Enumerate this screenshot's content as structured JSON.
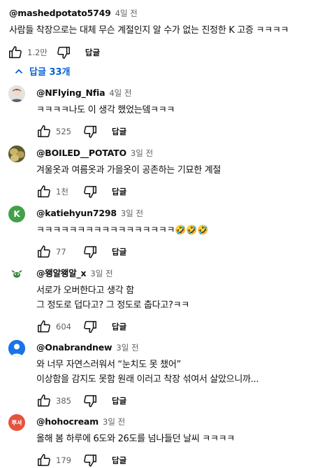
{
  "top_comment": {
    "handle": "@mashedpotato5749",
    "time": "4일 전",
    "text": "사람들 착장으로는 대체 무슨 계절인지 알 수가 없는 진정한 K 고증 ㅋㅋㅋㅋ",
    "likes": "1.2만",
    "reply_label": "답글"
  },
  "replies_toggle": {
    "label": "답글 33개",
    "icon": "chevron-up-icon",
    "color": "#065fd4"
  },
  "replies": [
    {
      "handle": "@NFlying_Nfia",
      "time": "4일 전",
      "lines": [
        "ㅋㅋㅋㅋ나도 이 생각 했었는뎈ㅋㅋㅋ"
      ],
      "likes": "525",
      "reply_label": "답글"
    },
    {
      "handle": "@BOILED__POTATO",
      "time": "3일 전",
      "lines": [
        "겨울옷과 여름옷과 가을옷이 공존하는 기묘한 계절"
      ],
      "likes": "1천",
      "reply_label": "답글"
    },
    {
      "handle": "@katiehyun7298",
      "time": "3일 전",
      "lines": [
        "ㅋㅋㅋㅋㅋㅋㅋㅋㅋㅋㅋㅋㅋㅋㅋㅋㅋ🤣🤣🤣"
      ],
      "likes": "77",
      "reply_label": "답글",
      "avatar_letter": "K"
    },
    {
      "handle": "@왱알왱알_x",
      "time": "3일 전",
      "lines": [
        "서로가 오버한다고 생각 함",
        "그 정도로 덥다고? 그 정도로 춥다고?ㅋㅋ"
      ],
      "likes": "604",
      "reply_label": "답글"
    },
    {
      "handle": "@Onabrandnew",
      "time": "3일 전",
      "lines": [
        "와 너무 자연스러워서 “눈치도 못 챘어”",
        "이상함을 감지도 못함 원래 이러고 착장 섞여서 살았으니까..."
      ],
      "likes": "385",
      "reply_label": "답글"
    },
    {
      "handle": "@hohocream",
      "time": "3일 전",
      "lines": [
        "올해 봄  하루에 6도와 26도를 넘나들던 날씨 ㅋㅋㅋㅋ"
      ],
      "likes": "179",
      "reply_label": "답글",
      "avatar_letter": "뿌셔"
    }
  ]
}
